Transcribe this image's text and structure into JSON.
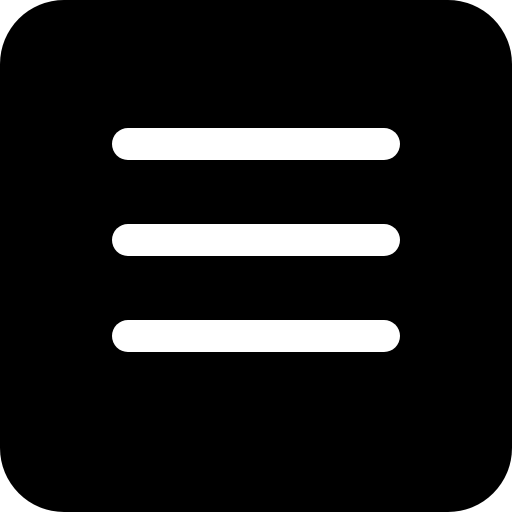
{
  "icon": {
    "name": "hamburger-menu-icon",
    "background_color": "#000000",
    "line_color": "#ffffff",
    "line_count": 3
  }
}
